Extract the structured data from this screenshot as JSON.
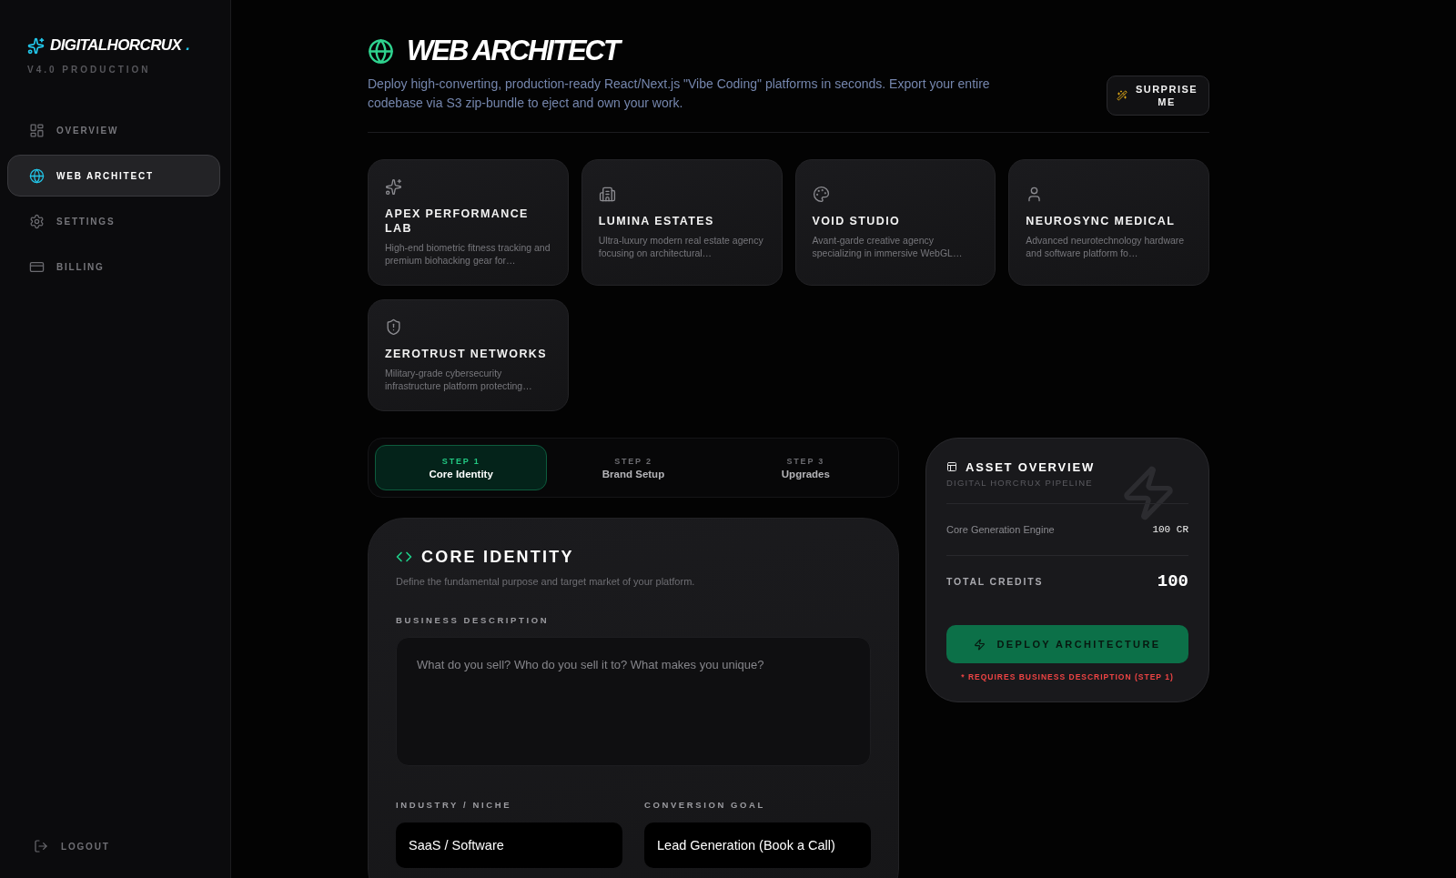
{
  "sidebar": {
    "brand": "DIGITALHORCRUX",
    "brand_suffix": ".",
    "version": "V4.0 PRODUCTION",
    "items": [
      {
        "label": "OVERVIEW",
        "selected": false
      },
      {
        "label": "WEB ARCHITECT",
        "selected": true
      },
      {
        "label": "SETTINGS",
        "selected": false
      },
      {
        "label": "BILLING",
        "selected": false
      }
    ],
    "logout": "LOGOUT"
  },
  "header": {
    "title": "WEB ARCHITECT",
    "description": "Deploy high-converting, production-ready React/Next.js \"Vibe Coding\" platforms in seconds. Export your entire codebase via S3 zip-bundle to eject and own your work.",
    "surprise_button": "SURPRISE ME"
  },
  "templates": [
    {
      "name": "APEX PERFORMANCE LAB",
      "description": "High-end biometric fitness tracking and premium biohacking gear for…"
    },
    {
      "name": "LUMINA ESTATES",
      "description": "Ultra-luxury modern real estate agency focusing on architectural…"
    },
    {
      "name": "VOID STUDIO",
      "description": "Avant-garde creative agency specializing in immersive WebGL…"
    },
    {
      "name": "NEUROSYNC MEDICAL",
      "description": "Advanced neurotechnology hardware and software platform fo…"
    },
    {
      "name": "ZEROTRUST NETWORKS",
      "description": "Military-grade cybersecurity infrastructure platform protecting…"
    }
  ],
  "steps": [
    {
      "step": "STEP 1",
      "label": "Core Identity",
      "selected": true
    },
    {
      "step": "STEP 2",
      "label": "Brand Setup",
      "selected": false
    },
    {
      "step": "STEP 3",
      "label": "Upgrades",
      "selected": false
    }
  ],
  "core_identity": {
    "title": "CORE IDENTITY",
    "subtitle": "Define the fundamental purpose and target market of your platform.",
    "business_description": {
      "label": "BUSINESS DESCRIPTION",
      "placeholder": "What do you sell? Who do you sell it to? What makes you unique?"
    },
    "industry": {
      "label": "INDUSTRY / NICHE",
      "value": "SaaS / Software"
    },
    "conversion_goal": {
      "label": "CONVERSION GOAL",
      "value": "Lead Generation (Book a Call)"
    }
  },
  "asset_overview": {
    "title": "ASSET OVERVIEW",
    "subtitle": "DIGITAL HORCRUX PIPELINE",
    "line_items": [
      {
        "label": "Core Generation Engine",
        "value": "100 CR"
      }
    ],
    "total_label": "TOTAL CREDITS",
    "total_value": "100",
    "deploy_button": {
      "label": "DEPLOY ARCHITECTURE",
      "disabled": true
    },
    "note": "* REQUIRES BUSINESS DESCRIPTION (STEP 1)"
  }
}
